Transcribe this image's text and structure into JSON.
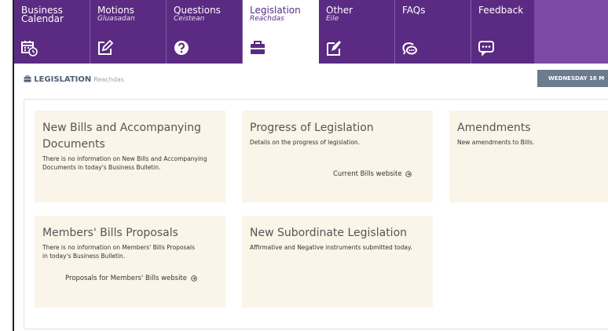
{
  "nav": {
    "tabs": [
      {
        "label": "Business Calendar",
        "label_ga": "",
        "icon": "calendar-clock-icon"
      },
      {
        "label": "Motions",
        "label_ga": "Gluasadan",
        "icon": "edit-icon"
      },
      {
        "label": "Questions",
        "label_ga": "Ceistean",
        "icon": "question-icon"
      },
      {
        "label": "Legislation",
        "label_ga": "Reachdas",
        "icon": "briefcase-icon",
        "active": true
      },
      {
        "label": "Other",
        "label_ga": "Eile",
        "icon": "note-pen-icon"
      },
      {
        "label": "FAQs",
        "label_ga": "",
        "icon": "chat-bubbles-icon"
      },
      {
        "label": "Feedback",
        "label_ga": "",
        "icon": "message-dots-icon"
      }
    ],
    "colors": {
      "bar": "#5b2a82",
      "fill": "#7c4aa4"
    }
  },
  "page": {
    "title": "LEGISLATION",
    "subtitle": "Reachdas",
    "date": "WEDNESDAY 16 M"
  },
  "cards": {
    "new_bills": {
      "title": "New Bills and Accompanying Documents",
      "text": "There is no information on New Bills and Accompanying Documents in today's Business Bulletin."
    },
    "progress": {
      "title": "Progress of Legislation",
      "text": "Details on the progress of legislation.",
      "link": "Current Bills website"
    },
    "amendments": {
      "title": "Amendments",
      "text": "New amendments to Bills."
    },
    "members_bills": {
      "title": "Members' Bills Proposals",
      "text": "There is no information on Members' Bills Proposals in today's Business Bulletin.",
      "link": "Proposals for Members' Bills website"
    },
    "subordinate": {
      "title": "New Subordinate Legislation",
      "text": "Affirmative and Negative instruments submitted today."
    }
  }
}
